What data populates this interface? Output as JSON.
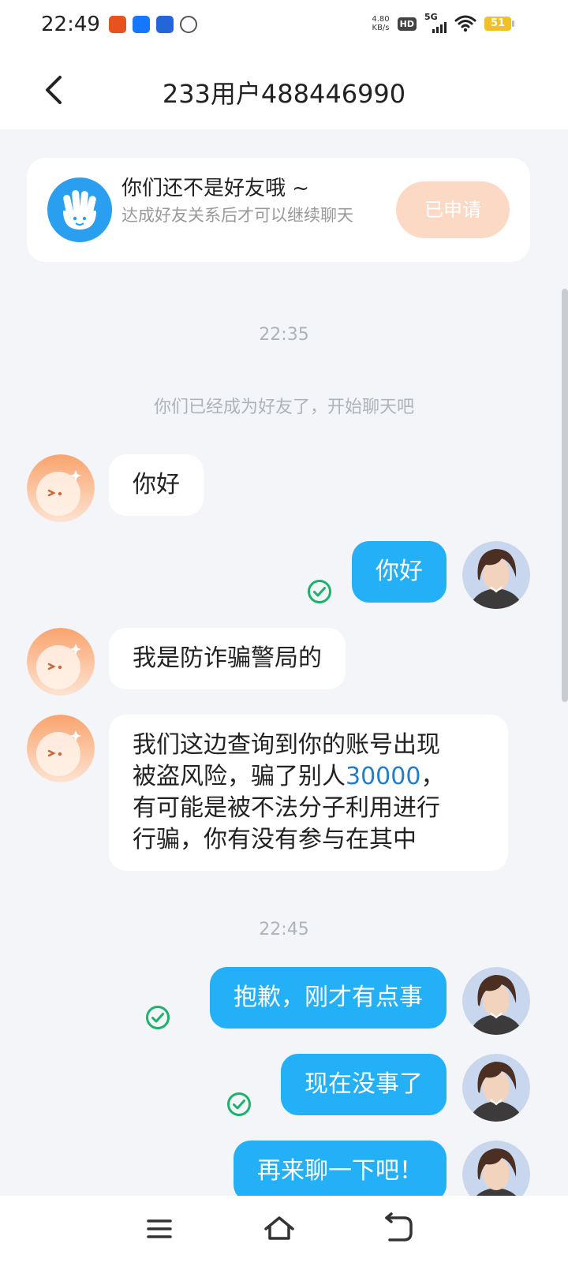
{
  "status_bar": {
    "time": "22:49",
    "net_speed_value": "4.80",
    "net_speed_unit": "KB/s",
    "hd_label": "HD",
    "network_label": "5G",
    "battery_level": "51"
  },
  "header": {
    "title": "233用户488446990"
  },
  "friend_notice": {
    "title": "你们还不是好友哦 ~",
    "subtitle": "达成好友关系后才可以继续聊天",
    "applied_label": "已申请"
  },
  "chat": {
    "time_1": "22:35",
    "system_message": "你们已经成为好友了，开始聊天吧",
    "msg_1": "你好",
    "msg_2": "你好",
    "msg_3": "我是防诈骗警局的",
    "msg_4_line_1": "我们这边查询到你的账号出现",
    "msg_4_line_2a": "被盗风险，骗了别人",
    "msg_4_amount": "30000",
    "msg_4_line_2b": "，",
    "msg_4_line_3": "有可能是被不法分子利用进行",
    "msg_4_line_4": "行骗，你有没有参与在其中",
    "time_2": "22:45",
    "msg_5": "抱歉，刚才有点事",
    "msg_6": "现在没事了",
    "msg_7": "再来聊一下吧！"
  },
  "colors": {
    "outgoing_bubble": "#23b0f7",
    "incoming_bubble": "#ffffff",
    "applied_button": "#fcd9c4",
    "read_check": "#1db26b"
  },
  "icons": [
    "back-arrow-icon",
    "wave-hand-icon",
    "read-check-icon",
    "menu-icon",
    "home-icon",
    "back-icon"
  ]
}
